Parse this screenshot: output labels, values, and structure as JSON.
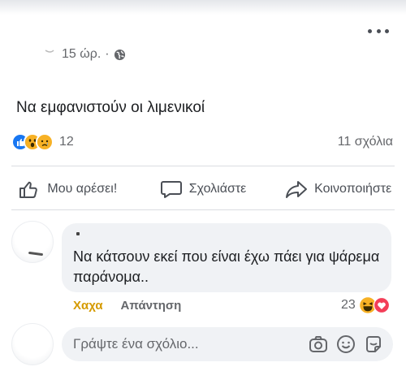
{
  "post": {
    "timestamp": "15 ώρ.",
    "separator": "·",
    "text": "Να εμφανιστούν οι λιμενικοί",
    "reaction_count": "12",
    "comments_count": "11 σχόλια"
  },
  "actions": {
    "like": "Μου αρέσει!",
    "comment": "Σχολιάστε",
    "share": "Κοινοποιήστε"
  },
  "comment": {
    "text": "Να κάτσουν εκεί που είναι έχω πάει για ψάρεμα παράνομα..",
    "haha_label": "Χαχα",
    "reply_label": "Απάντηση",
    "reaction_count": "23"
  },
  "composer": {
    "placeholder": "Γράψτε ένα σχόλιο..."
  },
  "colors": {
    "like_blue": "#1877f2",
    "haha_yellow": "#f7b125",
    "love_red": "#f33e58"
  }
}
